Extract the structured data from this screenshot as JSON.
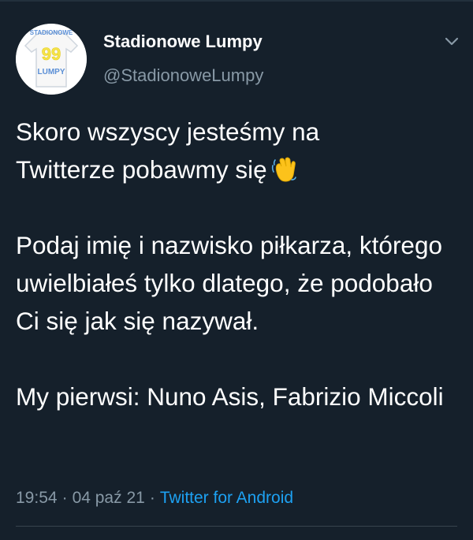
{
  "author": {
    "display_name": "Stadionowe Lumpy",
    "handle": "@StadionoweLumpy",
    "avatar": {
      "top_text": "STADIONOWE",
      "number": "99",
      "bottom_text": "LUMPY"
    }
  },
  "icons": {
    "menu": "chevron-down-icon",
    "emoji": "waving-hand-icon"
  },
  "tweet": {
    "line1": "Skoro wszyscy jesteśmy na",
    "line2": "Twitterze pobawmy się",
    "paragraph2": "Podaj imię i nazwisko piłkarza, którego uwielbiałeś tylko dlatego, że podobało Ci się jak się nazywał.",
    "paragraph3": "My pierwsi: Nuno Asis, Fabrizio Miccoli"
  },
  "meta": {
    "time": "19:54",
    "date": "04 paź 21",
    "source": "Twitter for Android"
  },
  "colors": {
    "background": "#15202b",
    "text": "#ffffff",
    "secondary": "#8899a6",
    "link": "#1da1f2",
    "jersey_number": "#f5e44a",
    "jersey_text": "#5b8fd6"
  }
}
